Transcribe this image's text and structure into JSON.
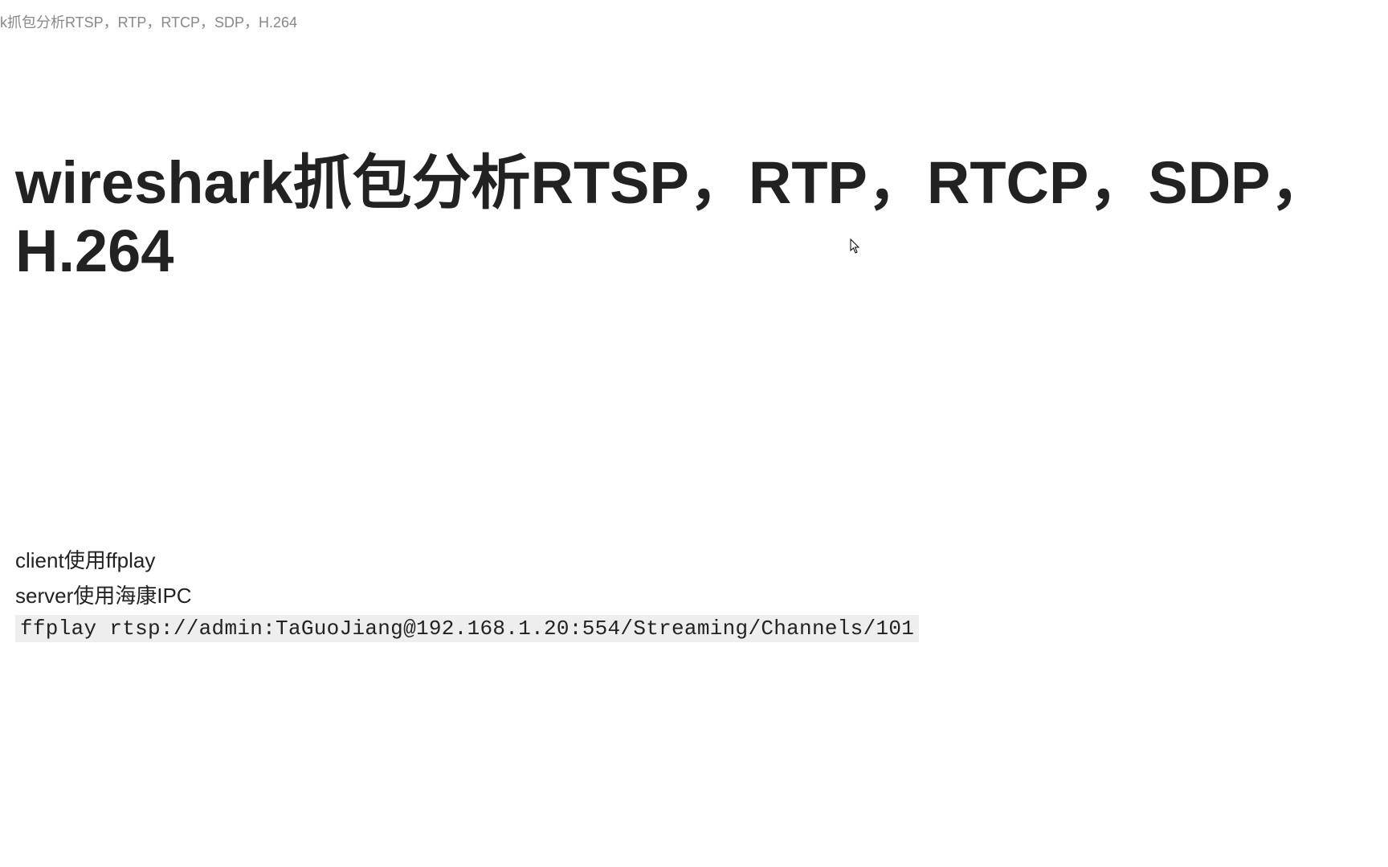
{
  "breadcrumb": "k抓包分析RTSP，RTP，RTCP，SDP，H.264",
  "title": "wireshark抓包分析RTSP，RTP，RTCP，SDP，H.264",
  "body": {
    "client_line": "client使用ffplay",
    "server_line": "server使用海康IPC",
    "code": "ffplay rtsp://admin:TaGuoJiang@192.168.1.20:554/Streaming/Channels/101"
  }
}
